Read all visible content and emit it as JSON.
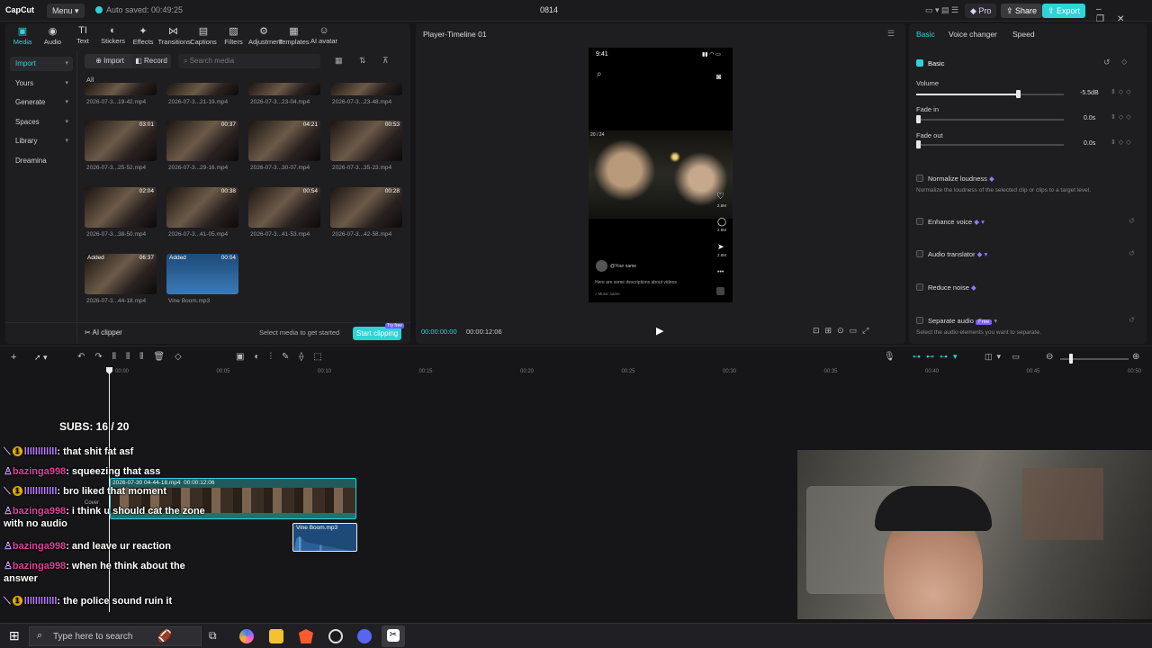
{
  "app": {
    "logo": "CapCut",
    "menu": "Menu",
    "autosave": "Auto saved: 00:49:25",
    "project": "0814",
    "pro": "Pro",
    "share": "Share",
    "export": "Export"
  },
  "toolbar": [
    {
      "icon": "▣",
      "label": "Media"
    },
    {
      "icon": "◉",
      "label": "Audio"
    },
    {
      "icon": "TI",
      "label": "Text"
    },
    {
      "icon": "◐",
      "label": "Stickers"
    },
    {
      "icon": "✦",
      "label": "Effects"
    },
    {
      "icon": "⋈",
      "label": "Transitions"
    },
    {
      "icon": "▤",
      "label": "Captions"
    },
    {
      "icon": "▨",
      "label": "Filters"
    },
    {
      "icon": "⚙",
      "label": "Adjustment"
    },
    {
      "icon": "▦",
      "label": "Templates"
    },
    {
      "icon": "☺",
      "label": "AI avatar"
    }
  ],
  "sidebar": [
    {
      "label": "Import"
    },
    {
      "label": "Yours"
    },
    {
      "label": "Generate"
    },
    {
      "label": "Spaces"
    },
    {
      "label": "Library"
    },
    {
      "label": "Dreamina"
    }
  ],
  "media": {
    "import_btn": "Import",
    "record_btn": "Record",
    "search_placeholder": "Search media",
    "all": "All",
    "rows": [
      [
        {
          "cap": "2026-07-3...19-42.mp4",
          "dur": ""
        },
        {
          "cap": "2026-07-3...21-19.mp4",
          "dur": ""
        },
        {
          "cap": "2026-07-3...23-04.mp4",
          "dur": ""
        },
        {
          "cap": "2026-07-3...23-48.mp4",
          "dur": ""
        }
      ],
      [
        {
          "cap": "2026-07-3...25-52.mp4",
          "dur": "03:01"
        },
        {
          "cap": "2026-07-3...29-16.mp4",
          "dur": "00:37"
        },
        {
          "cap": "2026-07-3...30-07.mp4",
          "dur": "04:21"
        },
        {
          "cap": "2026-07-3...35-23.mp4",
          "dur": "00:53"
        }
      ],
      [
        {
          "cap": "2026-07-3...38-50.mp4",
          "dur": "02:04"
        },
        {
          "cap": "2026-07-3...41-05.mp4",
          "dur": "00:38"
        },
        {
          "cap": "2026-07-3...41-53.mp4",
          "dur": "00:54"
        },
        {
          "cap": "2026-07-3...42-58.mp4",
          "dur": "00:28"
        }
      ],
      [
        {
          "cap": "2026-07-3...44-18.mp4",
          "dur": "06:37",
          "added": "Added"
        },
        {
          "cap": "Vine Boom.mp3",
          "dur": "00:04",
          "added": "Added"
        }
      ]
    ],
    "ai_clipper": "AI clipper",
    "select_hint": "Select media to get started",
    "start_clipping": "Start clipping",
    "try_free": "Try free"
  },
  "player": {
    "title": "Player-Timeline 01",
    "time_current": "00:00:00:00",
    "time_total": "00:00:12:06",
    "phone": {
      "clock": "9:41",
      "username": "@Your name",
      "description": "Here are some descriptions about videos",
      "music": "Music name",
      "counter": "20 / 24",
      "likes": "2.8M",
      "comments": "2.8M",
      "shares": "2.8M"
    }
  },
  "inspector": {
    "tabs": [
      "Basic",
      "Voice changer",
      "Speed"
    ],
    "section": "Basic",
    "volume_label": "Volume",
    "volume_value": "-5.5dB",
    "volume_fraction": 0.69,
    "fadein_label": "Fade in",
    "fadein_value": "0.0s",
    "fadeout_label": "Fade out",
    "fadeout_value": "0.0s",
    "normalize": "Normalize loudness",
    "normalize_desc": "Normalize the loudness of the selected clip or clips to a target level.",
    "enhance": "Enhance voice",
    "translator": "Audio translator",
    "reduce": "Reduce noise",
    "separate": "Separate audio",
    "separate_badge": "Free",
    "separate_desc": "Select the audio elements you want to separate."
  },
  "timeline": {
    "ticks": [
      "00:00",
      "00:05",
      "00:10",
      "00:15",
      "00:20",
      "00:25",
      "00:30",
      "00:35",
      "00:40",
      "00:45",
      "00:50"
    ],
    "video_clip_label": "2026-07-30 04-44-18.mp4",
    "video_clip_dur": "00:00:12:06",
    "audio_clip_label": "Vine Boom.mp3",
    "cover": "Cover"
  },
  "chat": {
    "subs": "SUBS: 16 / 20",
    "messages": [
      {
        "user": "llllllllllll",
        "text": ": that shit fat asf",
        "badge": "1"
      },
      {
        "user": "bazinga998",
        "text": ": squeezing that ass"
      },
      {
        "user": "llllllllllll",
        "text": ": bro liked that moment",
        "badge": "1"
      },
      {
        "user": "bazinga998",
        "text": ": i think u should cat the zone with no audio"
      },
      {
        "user": "bazinga998",
        "text": ": and leave ur reaction"
      },
      {
        "user": "bazinga998",
        "text": ": when he think about the answer"
      },
      {
        "user": "llllllllllll",
        "text": ": the police sound ruin it",
        "badge": "1"
      }
    ]
  },
  "taskbar": {
    "search_placeholder": "Type here to search"
  },
  "colors": {
    "accent": "#2dd4d8",
    "username": "#e0409a",
    "bars": "#b87bff"
  }
}
